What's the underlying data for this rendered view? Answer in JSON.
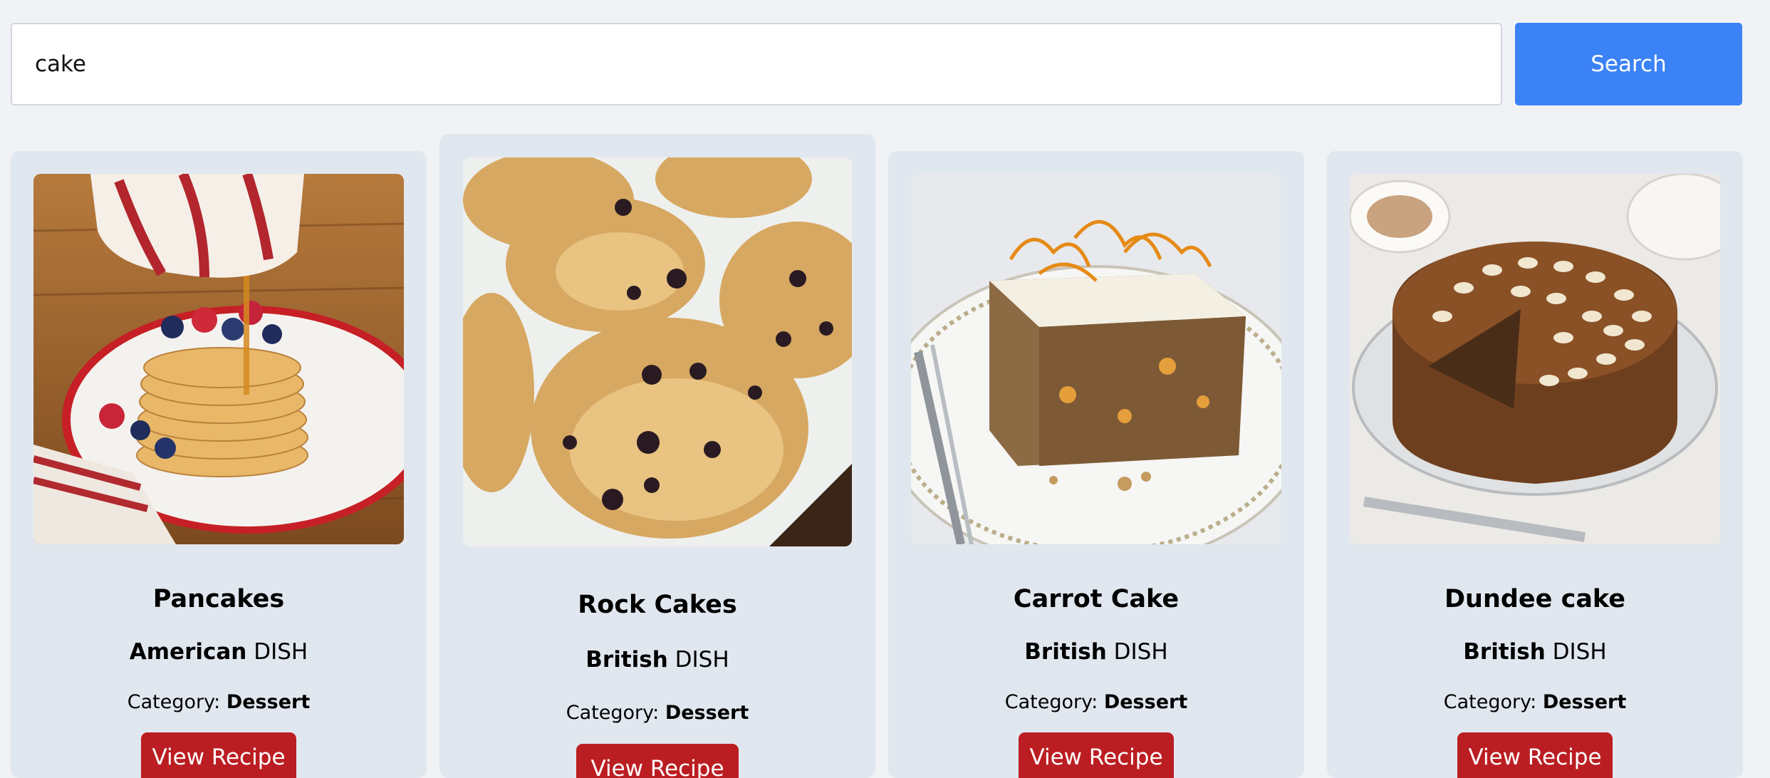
{
  "search": {
    "value": "cake",
    "button_label": "Search"
  },
  "labels": {
    "dish_suffix": "DISH",
    "category_prefix": "Category:",
    "view_recipe": "View Recipe"
  },
  "meals": [
    {
      "name": "Pancakes",
      "area": "American",
      "category": "Dessert",
      "image": "pancakes-photo"
    },
    {
      "name": "Rock Cakes",
      "area": "British",
      "category": "Dessert",
      "image": "rock-cakes-photo"
    },
    {
      "name": "Carrot Cake",
      "area": "British",
      "category": "Dessert",
      "image": "carrot-cake-photo"
    },
    {
      "name": "Dundee cake",
      "area": "British",
      "category": "Dessert",
      "image": "dundee-cake-photo"
    }
  ],
  "colors": {
    "page_background": "#f0f2f5",
    "card_background": "#e1e7ef",
    "search_button": "#3b82f6",
    "view_button": "#bb1e22"
  }
}
